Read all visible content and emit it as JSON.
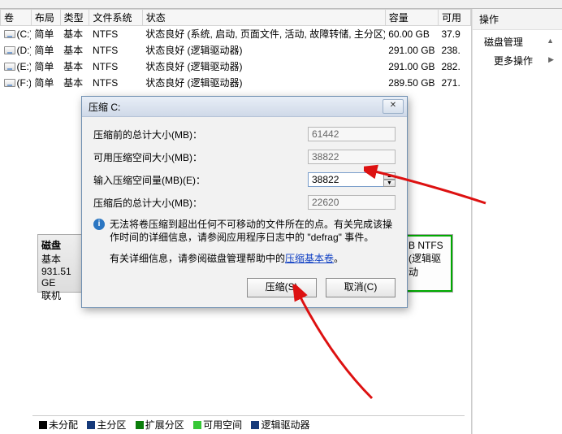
{
  "table": {
    "headers": {
      "volume": "卷",
      "layout": "布局",
      "type": "类型",
      "fs": "文件系统",
      "status": "状态",
      "capacity": "容量",
      "available": "可用"
    },
    "rows": [
      {
        "drive": "(C:)",
        "layout": "简单",
        "type": "基本",
        "fs": "NTFS",
        "status": "状态良好 (系统, 启动, 页面文件, 活动, 故障转储, 主分区)",
        "capacity": "60.00 GB",
        "available": "37.9"
      },
      {
        "drive": "(D:)",
        "layout": "简单",
        "type": "基本",
        "fs": "NTFS",
        "status": "状态良好 (逻辑驱动器)",
        "capacity": "291.00 GB",
        "available": "238."
      },
      {
        "drive": "(E:)",
        "layout": "简单",
        "type": "基本",
        "fs": "NTFS",
        "status": "状态良好 (逻辑驱动器)",
        "capacity": "291.00 GB",
        "available": "282."
      },
      {
        "drive": "(F:)",
        "layout": "简单",
        "type": "基本",
        "fs": "NTFS",
        "status": "状态良好 (逻辑驱动器)",
        "capacity": "289.50 GB",
        "available": "271."
      }
    ]
  },
  "disk_map": {
    "label_disk": "磁盘",
    "label_type": "基本",
    "label_size": "931.51 GE",
    "label_state": "联机",
    "vol_fs": "B NTFS",
    "vol_state": "(逻辑驱动"
  },
  "ops": {
    "header": "操作",
    "item1": "磁盘管理",
    "item2": "更多操作"
  },
  "legend": {
    "unalloc": "未分配",
    "primary": "主分区",
    "extended": "扩展分区",
    "free": "可用空间",
    "logical": "逻辑驱动器"
  },
  "dialog": {
    "title": "压缩 C:",
    "lbl_total_before": "压缩前的总计大小(MB)：",
    "val_total_before": "61442",
    "lbl_avail_shrink": "可用压缩空间大小(MB)：",
    "val_avail_shrink": "38822",
    "lbl_enter_shrink": "输入压缩空间量(MB)(E)：",
    "val_enter_shrink": "38822",
    "lbl_total_after": "压缩后的总计大小(MB)：",
    "val_total_after": "22620",
    "info_text1": "无法将卷压缩到超出任何不可移动的文件所在的点。有关完成该操作时间的详细信息，请参阅应用程序日志中的 \"defrag\" 事件。",
    "info_text2_a": "有关详细信息，请参阅磁盘管理帮助中的",
    "info_text2_link": "压缩基本卷",
    "info_text2_b": "。",
    "btn_shrink": "压缩(S)",
    "btn_cancel": "取消(C)"
  }
}
